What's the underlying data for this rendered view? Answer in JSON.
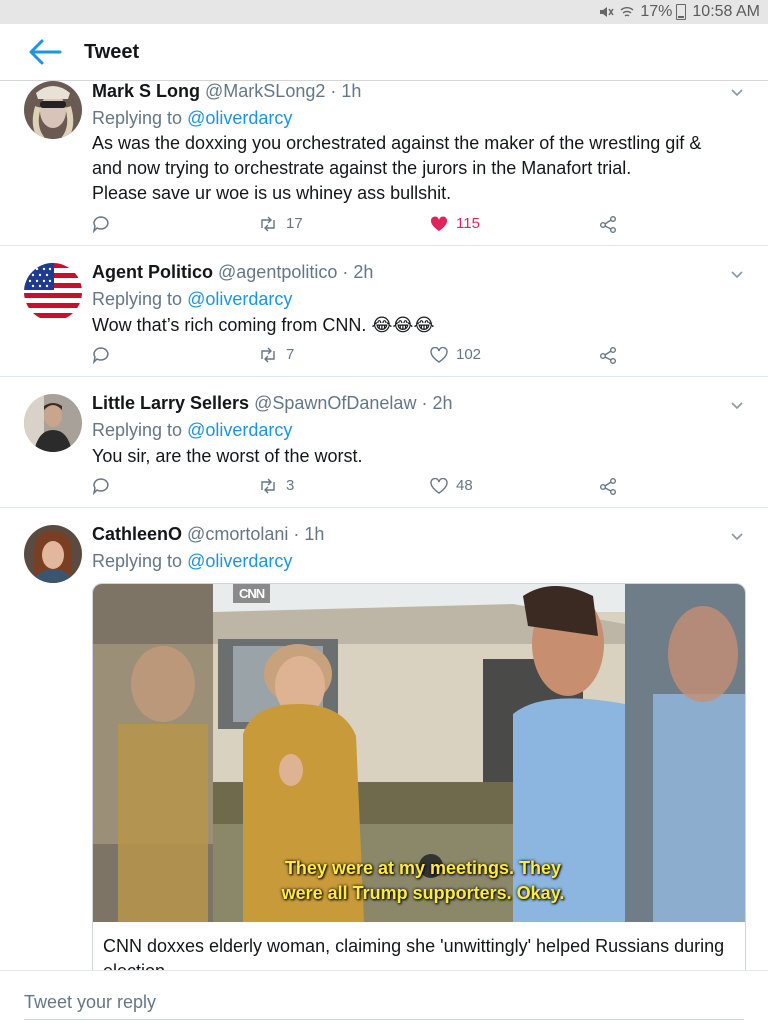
{
  "status_bar": {
    "battery": "17%",
    "time": "10:58 AM",
    "icons": [
      "mute-icon",
      "wifi-icon",
      "battery-icon"
    ]
  },
  "header": {
    "back_icon": "arrow-left-icon",
    "title": "Tweet"
  },
  "tweets": [
    {
      "name": "Mark S Long",
      "handle": "@MarkSLong2",
      "time": "· 1h",
      "replying_prefix": "Replying to ",
      "replying_to": "@oliverdarcy",
      "text_lines": [
        "As was the doxxing you orchestrated against the maker of the wrestling gif &",
        "and now trying to orchestrate against the jurors in the Manafort trial.",
        "Please save ur woe is us whiney ass bullshit."
      ],
      "retweets": "17",
      "likes": "115",
      "liked": true
    },
    {
      "name": "Agent Politico",
      "handle": "@agentpolitico",
      "time": "· 2h",
      "replying_prefix": "Replying to ",
      "replying_to": "@oliverdarcy",
      "text_lines": [
        "Wow that’s rich coming from CNN. 😂😂😂"
      ],
      "retweets": "7",
      "likes": "102",
      "liked": false
    },
    {
      "name": "Little Larry Sellers",
      "handle": "@SpawnOfDanelaw",
      "time": "· 2h",
      "replying_prefix": "Replying to ",
      "replying_to": "@oliverdarcy",
      "text_lines": [
        "You sir, are the worst of the worst."
      ],
      "retweets": "3",
      "likes": "48",
      "liked": false
    },
    {
      "name": "CathleenO",
      "handle": "@cmortolani",
      "time": "· 1h",
      "replying_prefix": "Replying to ",
      "replying_to": "@oliverdarcy",
      "media": {
        "logo": "CNN",
        "caption_line1": "They were at my meetings. They",
        "caption_line2": "were all Trump supporters. Okay.",
        "card_title": "CNN doxxes elderly woman, claiming she 'unwittingly' helped Russians during election"
      }
    }
  ],
  "reply_bar": {
    "placeholder": "Tweet your reply"
  },
  "colors": {
    "accent": "#1b95e0",
    "like": "#e0245e",
    "muted": "#657786"
  }
}
